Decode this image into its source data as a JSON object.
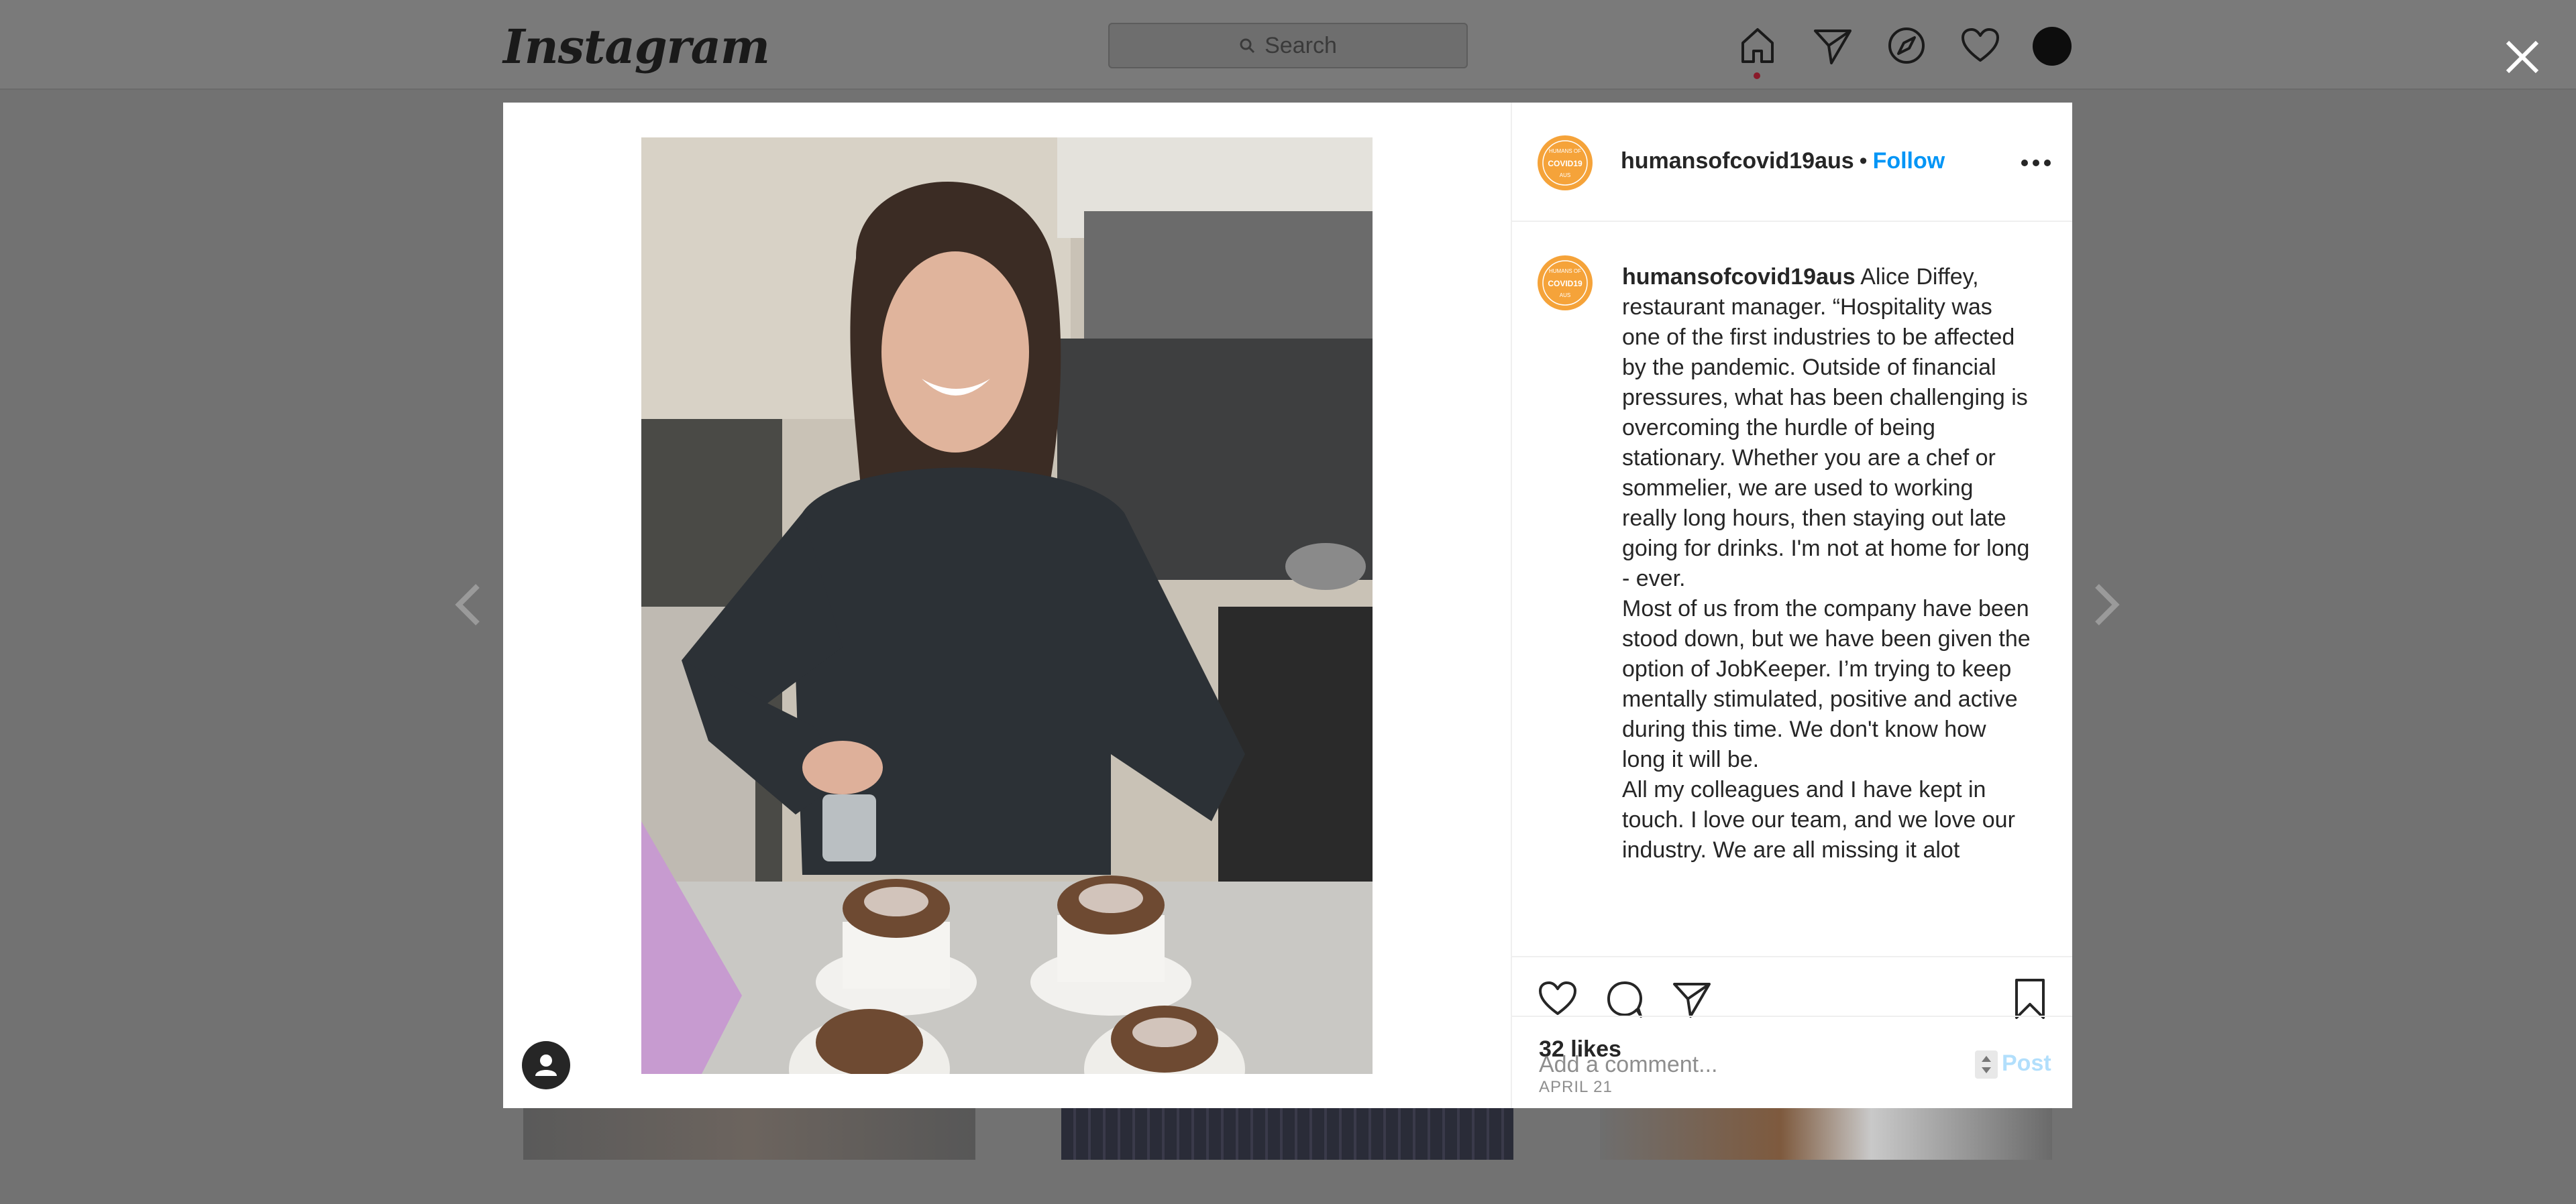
{
  "topbar": {
    "logo_text": "Instagram",
    "search_placeholder": "Search",
    "icons": [
      "home-icon",
      "direct-icon",
      "explore-icon",
      "activity-heart-icon",
      "profile-avatar"
    ]
  },
  "modal": {
    "post_user": "humansofcovid19aus",
    "separator": "•",
    "follow_label": "Follow",
    "badge_text_top": "HUMANS OF",
    "badge_text_mid": "COVID19",
    "badge_text_bot": "AUS",
    "caption": {
      "username": "humansofcovid19aus",
      "paragraph1": "Alice Diffey, restaurant manager. “Hospitality was one of the first industries to be affected by the pandemic. Outside of financial pressures, what has been challenging is overcoming the hurdle of being stationary. Whether you are a chef or sommelier, we are used to working really long hours, then staying out late going for drinks. I'm not at home for long - ever.",
      "paragraph2": "Most of us from the company have been stood down, but we have been given the option of JobKeeper. I’m trying to keep mentally stimulated, positive and active during this time. We don't know how long it will be.",
      "paragraph3": "All my colleagues and I have kept in touch. I love our team, and we love our industry. We are all missing it alot"
    },
    "likes": "32 likes",
    "date": "APRIL 21",
    "comment_placeholder": "Add a comment...",
    "post_label": "Post"
  },
  "colors": {
    "follow": "#0095f6",
    "post_disabled": "#b2dffc",
    "badge": "#f5a33a",
    "overlay": "#727272"
  }
}
